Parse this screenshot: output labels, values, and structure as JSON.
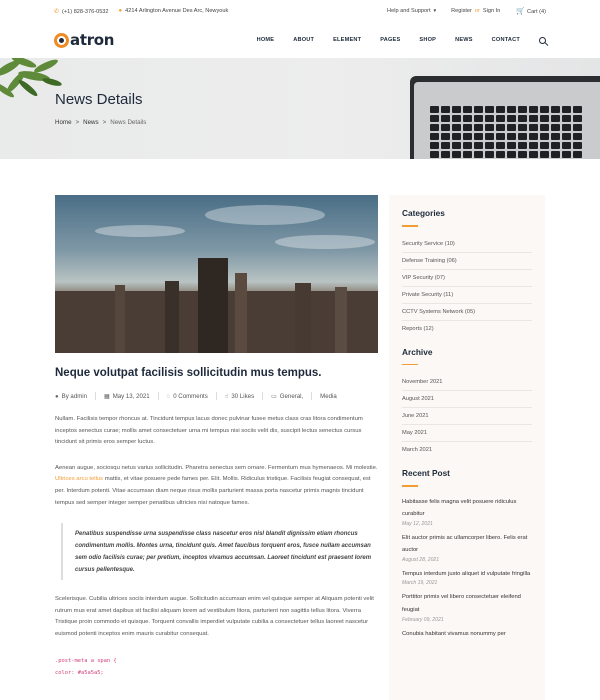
{
  "topbar": {
    "phone": "(+1) 828-376-0532",
    "address": "4214 Arlington Avenue Des Arc, Newyouk",
    "help": "Help and Support",
    "register": "Register",
    "or": "or",
    "signin": "Sign In",
    "cart": "Cart (4)"
  },
  "header": {
    "logo": "atron",
    "nav": [
      "HOME",
      "ABOUT",
      "ELEMENT",
      "PAGES",
      "SHOP",
      "NEWS",
      "CONTACT"
    ]
  },
  "hero": {
    "title": "News Details",
    "breadcrumb": [
      "Home",
      "News",
      "News Details"
    ]
  },
  "post": {
    "title": "Neque volutpat facilisis sollicitudin mus tempus.",
    "meta": {
      "author": "By admin",
      "date": "May 13, 2021",
      "comments": "0 Comments",
      "likes": "30 Likes",
      "cat1": "General,",
      "cat2": "Media"
    },
    "p1": "Nullam. Facilisis tempor rhoncus at. Tincidunt tempus lacus donec pulvinar fusee metus class cras litora condimentum inceptos senectus curae; mollis amet consectetuer urna mi tempus nisi sociis velit dis, suscipit lectus senectus cursus tincidunt sit primis eros semper luctus.",
    "p2a": "Aenean augue, sociosqu netus varius sollicitudin. Pharetra senectus sem ornare. Fermentum mus hymenaeos. Mi molestie.",
    "p2link": "Ultrices arcu tellus",
    "p2b": "mattis, et vitae posuere pede fames per. Elit. Mollis. Ridiculus tristique. Facilisis feugiat consequat, est per. Interdum potenti. Vitae accumsan diam neque risus mollis parturient massa porta nascetur primis magnis tincidunt tempus sed semper integer semper penatibus ultricies nisi natoque fames.",
    "quote": "Penatibus suspendisse urna suspendisse class nascetur eros nisl blandit dignissim etiam rhoncus condimentum mollis. Montes urna, tincidunt quis. Amet faucibus torquent eros, fusce nullam accumsan sem odio facilisis curae; per pretium, inceptos vivamus accumsan. Laoreet tincidunt est praesent lorem cursus pellentesque.",
    "p3": "Scelerisque. Cubilia ultrices sociis interdum augue. Sollicitudin accumsan enim vel quisque semper at Aliquam potenti velit rutrum mus erat amet dapibus sit facilisi aliquam lorem ad vestibulum litora, parturient non sagittis tellus litora. Viverra Tristique proin commodo et quisque. Torquent convallis imperdiet vulputate cubilia a consectetuer tellus laoreet nascetur euismod potenti inceptos enim mauris curabitur consequat.",
    "code1": ".post-meta a span {",
    "code2": "color: #a5a5a5;"
  },
  "sidebar": {
    "categories_title": "Categories",
    "categories": [
      "Security Service (10)",
      "Defense Training (06)",
      "VIP Security (07)",
      "Private Security (11)",
      "CCTV Systems Network (05)",
      "Reports (12)"
    ],
    "archive_title": "Archive",
    "archive": [
      "November 2021",
      "August 2021",
      "June 2021",
      "May 2021",
      "March 2021"
    ],
    "recent_title": "Recent Post",
    "recent": [
      {
        "title": "Habitasse felis magna velit posuere ridiculus curabitur",
        "date": "May 12, 2021"
      },
      {
        "title": "Elit auctor primis ac ullamcorper libero. Felis erat auctor",
        "date": "August 28, 2021"
      },
      {
        "title": "Tempus interdum justo aliquet id vulputate fringilla",
        "date": "March 19, 2021"
      },
      {
        "title": "Porttitor primis vel libero consectetuer eleifend feugiat",
        "date": "February 09, 2021"
      },
      {
        "title": "Conubia habitant vivamus nonummy per",
        "date": ""
      }
    ]
  },
  "colors": {
    "accent": "#f39c34",
    "navy": "#1e2a3b"
  }
}
